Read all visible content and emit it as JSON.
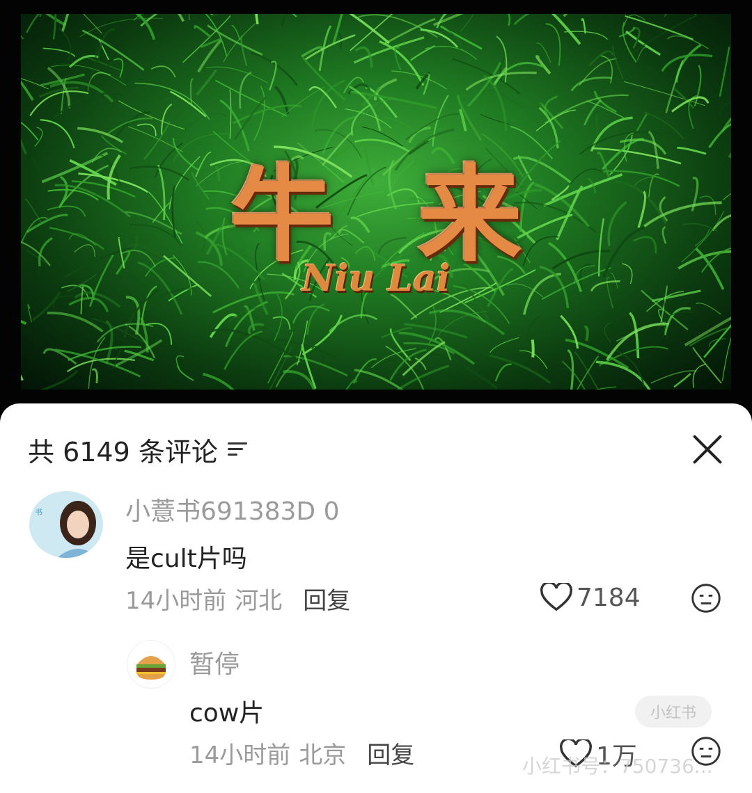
{
  "video": {
    "title_cn": "牛来",
    "title_en": "Niu Lai"
  },
  "comments_panel": {
    "header": "共 6149 条评论",
    "close_label": "close",
    "comments": [
      {
        "username": "小薏书691383D 0",
        "text": "是cult片吗",
        "time": "14小时前",
        "location": "河北",
        "reply": "回复",
        "likes": "7184"
      }
    ],
    "reply": {
      "username": "暂停",
      "text": "cow片",
      "time": "14小时前",
      "location": "北京",
      "reply": "回复",
      "likes": "1万"
    },
    "watermark": "小红书号：750736..."
  },
  "colors": {
    "sheet_bg": "#ffffff",
    "muted_text": "#9a9a9a",
    "grass": "#2f8f2c",
    "title_orange": "#e48a45"
  }
}
